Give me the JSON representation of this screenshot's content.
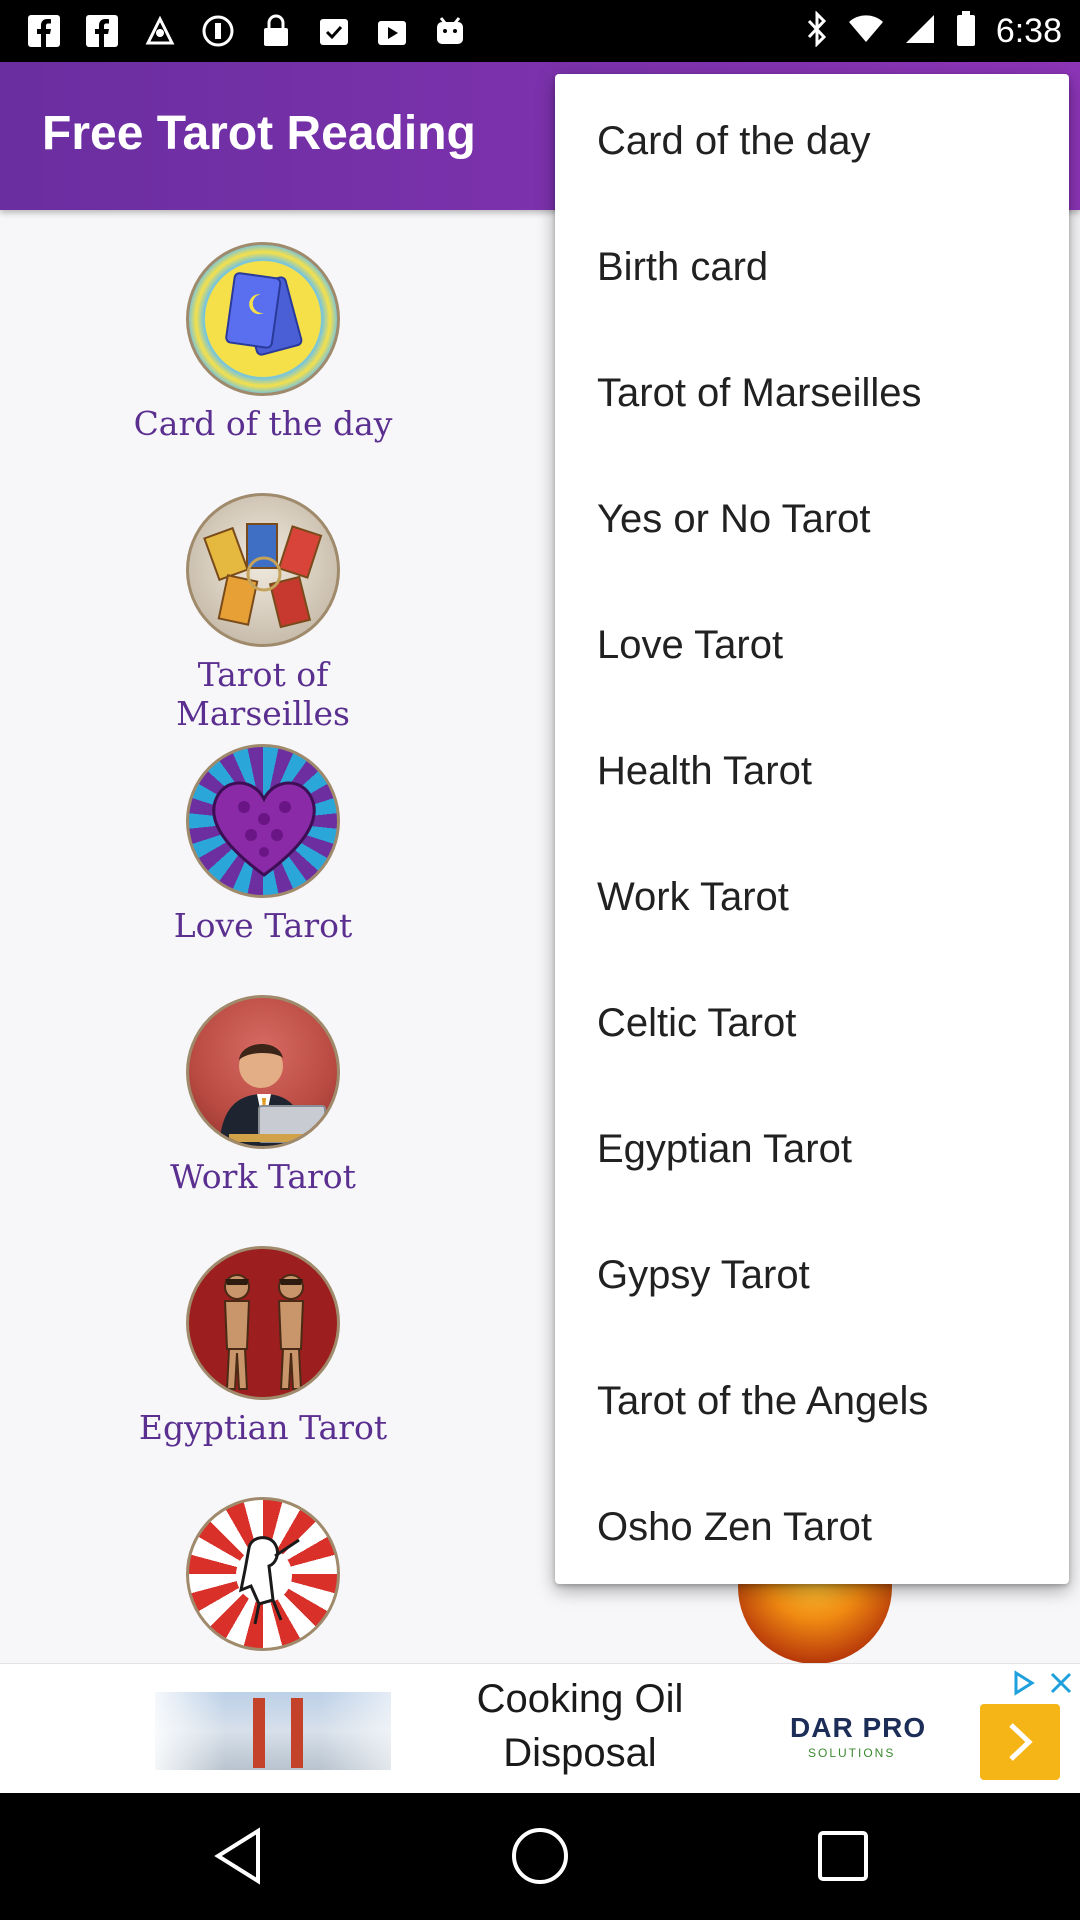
{
  "status_bar": {
    "time": "6:38",
    "icons": [
      "facebook-icon",
      "facebook-icon",
      "fake-gps-icon",
      "circle-icon",
      "lock-icon",
      "clipboard-check-icon",
      "play-store-icon",
      "android-icon",
      "bluetooth-icon",
      "wifi-icon",
      "signal-icon",
      "battery-icon"
    ]
  },
  "app_bar": {
    "title": "Free Tarot Reading"
  },
  "grid": {
    "items": [
      {
        "label": "Card of the day"
      },
      {
        "label": "Tarot of Marseilles"
      },
      {
        "label": "Love Tarot"
      },
      {
        "label": "Work Tarot"
      },
      {
        "label": "Egyptian Tarot"
      }
    ]
  },
  "menu": {
    "items": [
      {
        "label": "Card of the day"
      },
      {
        "label": "Birth card"
      },
      {
        "label": "Tarot of Marseilles"
      },
      {
        "label": "Yes or No Tarot"
      },
      {
        "label": "Love Tarot"
      },
      {
        "label": "Health Tarot"
      },
      {
        "label": "Work Tarot"
      },
      {
        "label": "Celtic Tarot"
      },
      {
        "label": "Egyptian Tarot"
      },
      {
        "label": "Gypsy Tarot"
      },
      {
        "label": "Tarot of the Angels"
      },
      {
        "label": "Osho Zen Tarot"
      }
    ]
  },
  "ad": {
    "headline": "Cooking Oil Disposal",
    "brand": "DAR PRO",
    "brand_sub": "SOLUTIONS"
  },
  "colors": {
    "appbar": "#7b31ad",
    "label": "#5a2f8f",
    "menu_bg": "#ffffff",
    "cta": "#f5b516"
  }
}
